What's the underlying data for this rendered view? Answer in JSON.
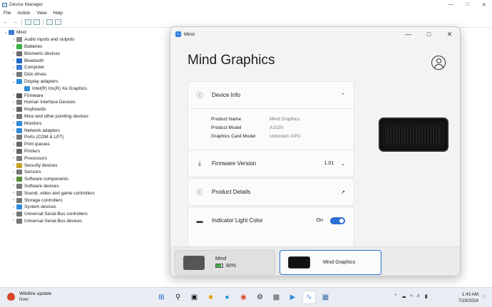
{
  "device_manager": {
    "title": "Device Manager",
    "window_controls": [
      "—",
      "□",
      "✕"
    ],
    "menu": [
      "File",
      "Action",
      "View",
      "Help"
    ],
    "root": "Mind",
    "tree": [
      {
        "label": "Audio inputs and outputs",
        "expanded": false,
        "color": "#8a8a8a"
      },
      {
        "label": "Batteries",
        "expanded": false,
        "color": "#3cb043"
      },
      {
        "label": "Biometric devices",
        "expanded": false,
        "color": "#6b6b6b"
      },
      {
        "label": "Bluetooth",
        "expanded": false,
        "color": "#1f66cc"
      },
      {
        "label": "Computer",
        "expanded": false,
        "color": "#3a7bd5"
      },
      {
        "label": "Disk drives",
        "expanded": false,
        "color": "#777777"
      },
      {
        "label": "Display adapters",
        "expanded": true,
        "color": "#2e8bd8"
      },
      {
        "label": "Intel(R) Iris(R) Xe Graphics",
        "child": true,
        "color": "#2e8bd8"
      },
      {
        "label": "Firmware",
        "expanded": false,
        "color": "#555555"
      },
      {
        "label": "Human Interface Devices",
        "expanded": false,
        "color": "#7a7a7a"
      },
      {
        "label": "Keyboards",
        "expanded": false,
        "color": "#666666"
      },
      {
        "label": "Mice and other pointing devices",
        "expanded": false,
        "color": "#777777"
      },
      {
        "label": "Monitors",
        "expanded": false,
        "color": "#2e8bd8"
      },
      {
        "label": "Network adapters",
        "expanded": false,
        "color": "#2e8bd8"
      },
      {
        "label": "Ports (COM & LPT)",
        "expanded": false,
        "color": "#777777"
      },
      {
        "label": "Print queues",
        "expanded": false,
        "color": "#666666"
      },
      {
        "label": "Printers",
        "expanded": false,
        "color": "#666666"
      },
      {
        "label": "Processors",
        "expanded": false,
        "color": "#7a7a7a"
      },
      {
        "label": "Security devices",
        "expanded": false,
        "color": "#c9a227"
      },
      {
        "label": "Sensors",
        "expanded": false,
        "color": "#777777"
      },
      {
        "label": "Software components",
        "expanded": false,
        "color": "#5a8f3a"
      },
      {
        "label": "Software devices",
        "expanded": false,
        "color": "#777777"
      },
      {
        "label": "Sound, video and game controllers",
        "expanded": false,
        "color": "#8a8a8a"
      },
      {
        "label": "Storage controllers",
        "expanded": false,
        "color": "#777777"
      },
      {
        "label": "System devices",
        "expanded": false,
        "color": "#2e8bd8"
      },
      {
        "label": "Universal Serial Bus controllers",
        "expanded": false,
        "color": "#777777"
      },
      {
        "label": "Universal Serial Bus devices",
        "expanded": false,
        "color": "#777777"
      }
    ]
  },
  "mind_app": {
    "title": "Mind",
    "window_controls": [
      "—",
      "□",
      "✕"
    ],
    "heading": "Mind Graphics",
    "device_info": {
      "label": "Device Info",
      "fields": [
        {
          "key": "Product Name",
          "value": "Mind Graphics"
        },
        {
          "key": "Product Model",
          "value": "A1020"
        },
        {
          "key": "Graphics Card Model",
          "value": "Unknown GPU"
        }
      ]
    },
    "firmware": {
      "label": "Firmware Version",
      "value": "1.01"
    },
    "product_details": {
      "label": "Product Details"
    },
    "indicator": {
      "label": "Indicator Light Color",
      "state": "On"
    },
    "devices": [
      {
        "name": "Mind",
        "battery": "80%",
        "battery_level": 0.8
      },
      {
        "name": "Mind Graphics"
      }
    ]
  },
  "taskbar": {
    "weather_title": "Wildfire update",
    "weather_sub": "Now",
    "time": "1:43 AM",
    "date": "7/29/2024",
    "colors": {
      "accent": "#2a6fd1",
      "taskbar": "#e9edf3"
    }
  }
}
